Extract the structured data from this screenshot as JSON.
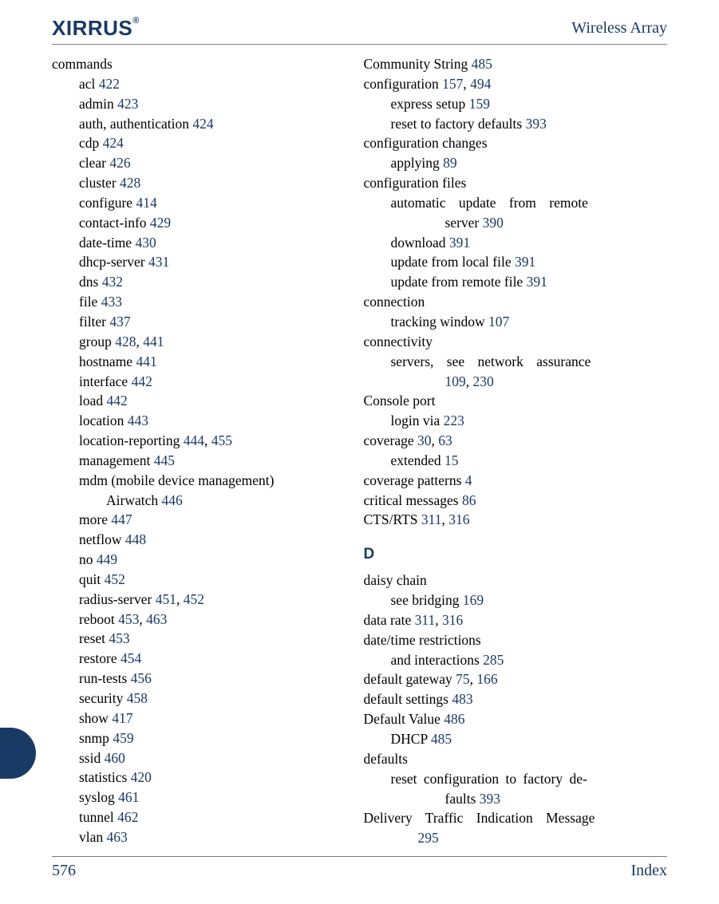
{
  "header": {
    "logo_text": "XIRRUS",
    "logo_reg": "®",
    "right": "Wireless Array"
  },
  "footer": {
    "page_number": "576",
    "section": "Index"
  },
  "left_column": {
    "commands_heading": "commands",
    "items": {
      "acl": {
        "label": "acl ",
        "pg": "422"
      },
      "admin": {
        "label": "admin ",
        "pg": "423"
      },
      "auth": {
        "label": "auth, authentication ",
        "pg": "424"
      },
      "cdp": {
        "label": "cdp ",
        "pg": "424"
      },
      "clear": {
        "label": "clear ",
        "pg": "426"
      },
      "cluster": {
        "label": "cluster ",
        "pg": "428"
      },
      "configure": {
        "label": "configure ",
        "pg": "414"
      },
      "contact": {
        "label": "contact-info ",
        "pg": "429"
      },
      "datetime": {
        "label": "date-time ",
        "pg": "430"
      },
      "dhcp": {
        "label": "dhcp-server ",
        "pg": "431"
      },
      "dns": {
        "label": "dns ",
        "pg": "432"
      },
      "file": {
        "label": "file ",
        "pg": "433"
      },
      "filter": {
        "label": "filter ",
        "pg": "437"
      },
      "group": {
        "label": "group ",
        "pg1": "428",
        "sep": ", ",
        "pg2": "441"
      },
      "hostname": {
        "label": "hostname ",
        "pg": "441"
      },
      "interface": {
        "label": "interface ",
        "pg": "442"
      },
      "load": {
        "label": "load ",
        "pg": "442"
      },
      "location": {
        "label": "location ",
        "pg": "443"
      },
      "locrep": {
        "label": "location-reporting ",
        "pg1": "444",
        "sep": ", ",
        "pg2": "455"
      },
      "mgmt": {
        "label": "management ",
        "pg": "445"
      },
      "mdm_line": "mdm (mobile device management)",
      "airwatch": {
        "label": "Airwatch ",
        "pg": "446"
      },
      "more": {
        "label": "more ",
        "pg": "447"
      },
      "netflow": {
        "label": "netflow ",
        "pg": "448"
      },
      "no": {
        "label": "no ",
        "pg": "449"
      },
      "quit": {
        "label": "quit ",
        "pg": "452"
      },
      "radius": {
        "label": "radius-server ",
        "pg1": "451",
        "sep": ", ",
        "pg2": "452"
      },
      "reboot": {
        "label": "reboot ",
        "pg1": "453",
        "sep": ", ",
        "pg2": "463"
      },
      "reset": {
        "label": "reset ",
        "pg": "453"
      },
      "restore": {
        "label": "restore ",
        "pg": "454"
      },
      "runtests": {
        "label": "run-tests ",
        "pg": "456"
      },
      "security": {
        "label": "security ",
        "pg": "458"
      },
      "show": {
        "label": "show ",
        "pg": "417"
      },
      "snmp": {
        "label": "snmp ",
        "pg": "459"
      },
      "ssid": {
        "label": "ssid ",
        "pg": "460"
      },
      "statistics": {
        "label": "statistics ",
        "pg": "420"
      },
      "syslog": {
        "label": "syslog ",
        "pg": "461"
      },
      "tunnel": {
        "label": "tunnel ",
        "pg": "462"
      },
      "vlan": {
        "label": "vlan ",
        "pg": "463"
      }
    }
  },
  "right_column": {
    "community": {
      "label": "Community String ",
      "pg": "485"
    },
    "configuration": {
      "label": "configuration ",
      "pg1": "157",
      "sep": ", ",
      "pg2": "494"
    },
    "express_setup": {
      "label": "express setup ",
      "pg": "159"
    },
    "reset_defaults": {
      "label": "reset to factory defaults ",
      "pg": "393"
    },
    "conf_changes_heading": "configuration changes",
    "applying": {
      "label": "applying ",
      "pg": "89"
    },
    "conf_files_heading": "configuration files",
    "auto_update_l1": "automatic update from remote",
    "auto_update_l2_label": "server ",
    "auto_update_l2_pg": "390",
    "download": {
      "label": "download ",
      "pg": "391"
    },
    "update_local": {
      "label": "update from local file ",
      "pg": "391"
    },
    "update_remote": {
      "label": "update from remote file ",
      "pg": "391"
    },
    "connection_heading": "connection",
    "tracking": {
      "label": "tracking window ",
      "pg": "107"
    },
    "connectivity_heading": "connectivity",
    "servers_l1": "servers, see network assurance",
    "servers_l2_pg1": "109",
    "servers_l2_sep": ", ",
    "servers_l2_pg2": "230",
    "console_heading": "Console port",
    "login_via": {
      "label": "login via ",
      "pg": "223"
    },
    "coverage": {
      "label": "coverage ",
      "pg1": "30",
      "sep": ", ",
      "pg2": "63"
    },
    "extended": {
      "label": "extended ",
      "pg": "15"
    },
    "coverage_patterns": {
      "label": "coverage patterns ",
      "pg": "4"
    },
    "critical": {
      "label": "critical messages ",
      "pg": "86"
    },
    "ctsrts": {
      "label": "CTS/RTS ",
      "pg1": "311",
      "sep": ", ",
      "pg2": "316"
    },
    "d_heading": "D",
    "daisy_heading": "daisy chain",
    "bridging": {
      "label": "see bridging ",
      "pg": "169"
    },
    "data_rate": {
      "label": "data rate ",
      "pg1": "311",
      "sep": ", ",
      "pg2": "316"
    },
    "datetime_restr_heading": "date/time restrictions",
    "interactions": {
      "label": "and interactions ",
      "pg": "285"
    },
    "def_gateway": {
      "label": "default gateway ",
      "pg1": "75",
      "sep": ", ",
      "pg2": "166"
    },
    "def_settings": {
      "label": "default settings ",
      "pg": "483"
    },
    "def_value": {
      "label": "Default Value ",
      "pg": "486"
    },
    "dhcp": {
      "label": "DHCP ",
      "pg": "485"
    },
    "defaults_heading": "defaults",
    "reset_conf_l1": "reset configuration to factory de-",
    "reset_conf_l2_label": "faults ",
    "reset_conf_l2_pg": "393",
    "delivery_l1": "Delivery Traffic Indication Message",
    "delivery_l2_pg": "295"
  }
}
